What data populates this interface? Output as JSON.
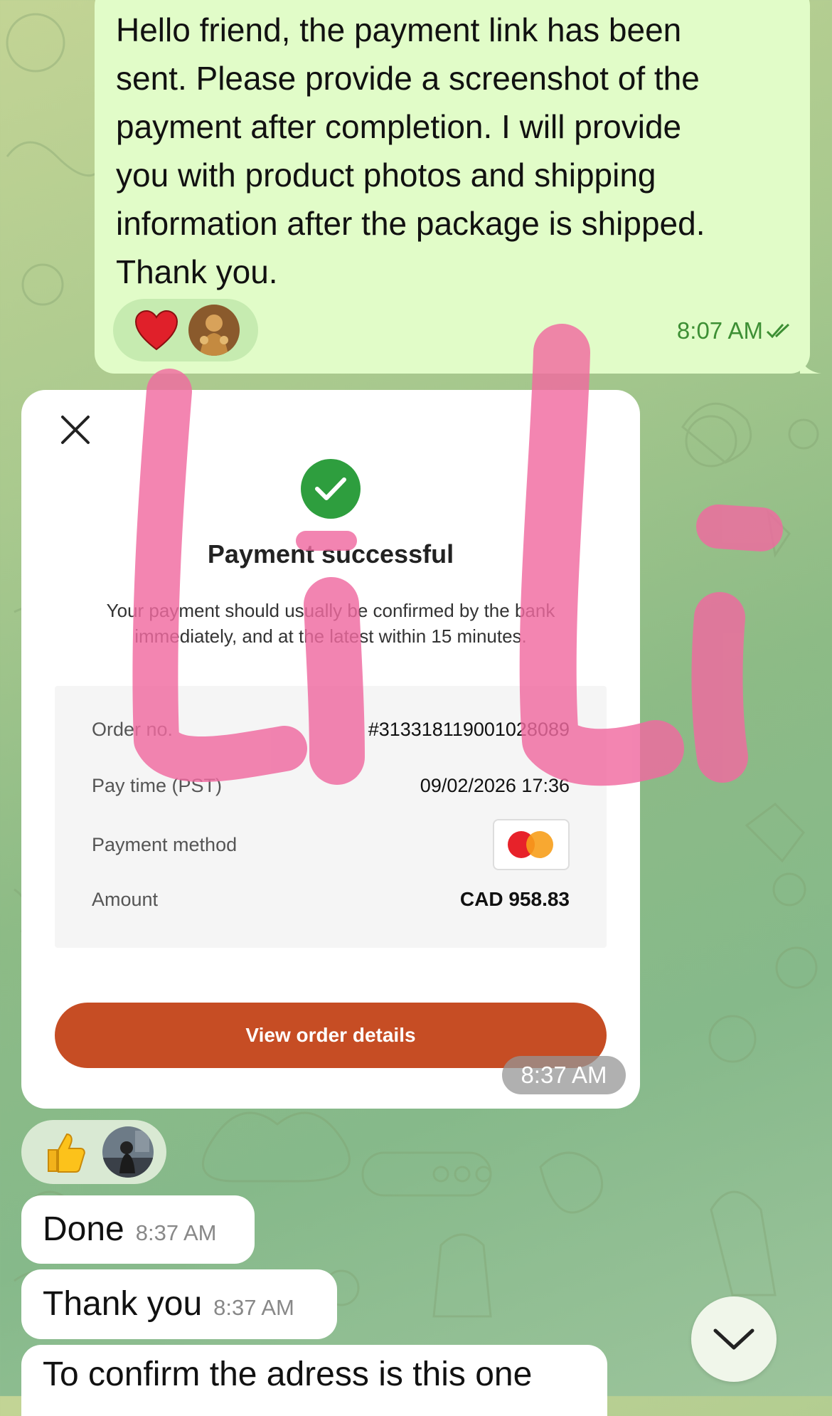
{
  "chat": {
    "outgoing": {
      "text": "Hello friend, the payment link has been\nsent. Please provide a screenshot of the\npayment after completion. I will provide\nyou with product photos and shipping\ninformation after the package is shipped.\nThank you.",
      "time": "8:07 AM",
      "reactions": [
        "heart-emoji",
        "avatar"
      ]
    },
    "payment_card": {
      "title": "Payment successful",
      "subtitle": "Your payment should usually be confirmed by the bank immediately, and at the latest within 15 minutes.",
      "rows": [
        {
          "label": "Order no.",
          "value": "#31331811900102808​9"
        },
        {
          "label": "Pay time (PST)",
          "value": "09/02/2026 17:36"
        },
        {
          "label": "Payment method",
          "value": ""
        },
        {
          "label": "Amount",
          "value": "CAD 958.83"
        }
      ],
      "button": "View order details",
      "time": "8:37 AM",
      "overlay_text": "Li Li"
    },
    "incoming_reactions": [
      "thumbs-up-emoji",
      "avatar"
    ],
    "messages": [
      {
        "text": "Done",
        "time": "8:37 AM"
      },
      {
        "text": "Thank you",
        "time": "8:37 AM"
      },
      {
        "text": "To confirm  the adress is this one",
        "time": ""
      }
    ]
  },
  "colors": {
    "outgoing_bubble": "#e1fcc8",
    "time_green": "#3d8f34",
    "success_green": "#2e9e3e",
    "button_orange": "#c64d24",
    "scribble_pink": "#f06aa0"
  }
}
